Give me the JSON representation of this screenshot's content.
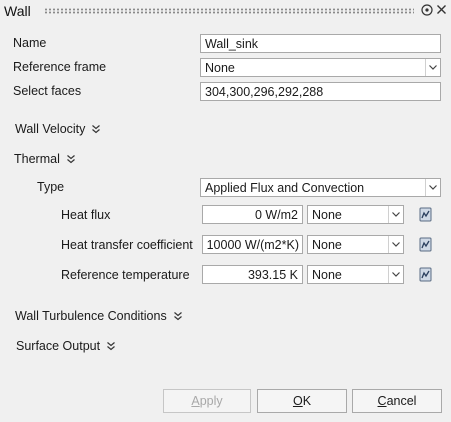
{
  "window": {
    "title": "Wall",
    "help_glyph": "⓪",
    "close_glyph": "✕"
  },
  "fields": {
    "name_label": "Name",
    "name_value": "Wall_sink",
    "ref_frame_label": "Reference frame",
    "ref_frame_value": "None",
    "select_faces_label": "Select faces",
    "select_faces_value": "304,300,296,292,288"
  },
  "sections": {
    "wall_velocity": "Wall Velocity",
    "thermal": "Thermal",
    "wall_turbulence": "Wall Turbulence Conditions",
    "surface_output": "Surface Output"
  },
  "thermal": {
    "type_label": "Type",
    "type_value": "Applied Flux and Convection",
    "rows": [
      {
        "label": "Heat flux",
        "value": "0 W/m2",
        "option": "None"
      },
      {
        "label": "Heat transfer coefficient",
        "value": "10000 W/(m2*K)",
        "option": "None"
      },
      {
        "label": "Reference temperature",
        "value": "393.15 K",
        "option": "None"
      }
    ]
  },
  "buttons": {
    "apply_first": "A",
    "apply_rest": "pply",
    "ok_first": "O",
    "ok_rest": "K",
    "cancel_first": "C",
    "cancel_rest": "ancel"
  },
  "colors": {
    "background": "#f0f0f0",
    "field_border": "#a9a9a9",
    "disabled_text": "#a8a8a8"
  }
}
